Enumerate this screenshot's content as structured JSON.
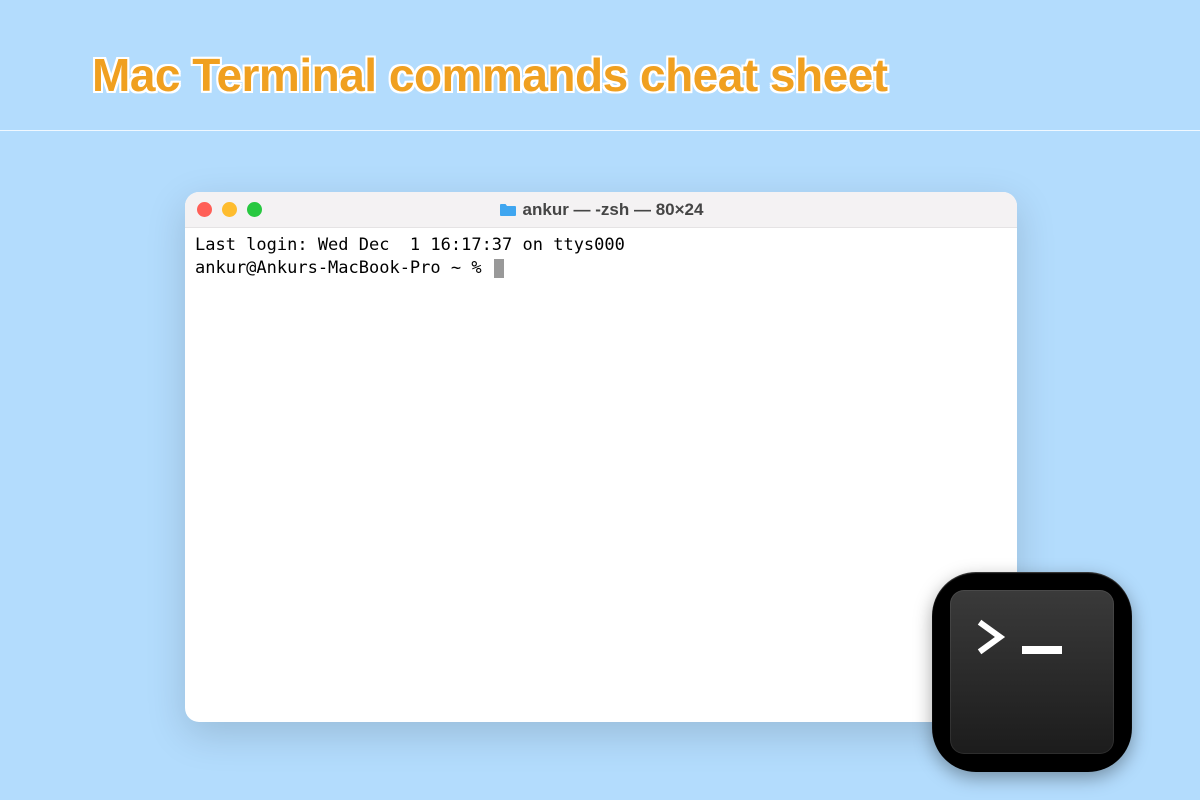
{
  "page": {
    "title": "Mac Terminal commands cheat sheet"
  },
  "terminal": {
    "window_title": "ankur — -zsh — 80×24",
    "last_login": "Last login: Wed Dec  1 16:17:37 on ttys000",
    "prompt": "ankur@Ankurs-MacBook-Pro ~ % "
  }
}
